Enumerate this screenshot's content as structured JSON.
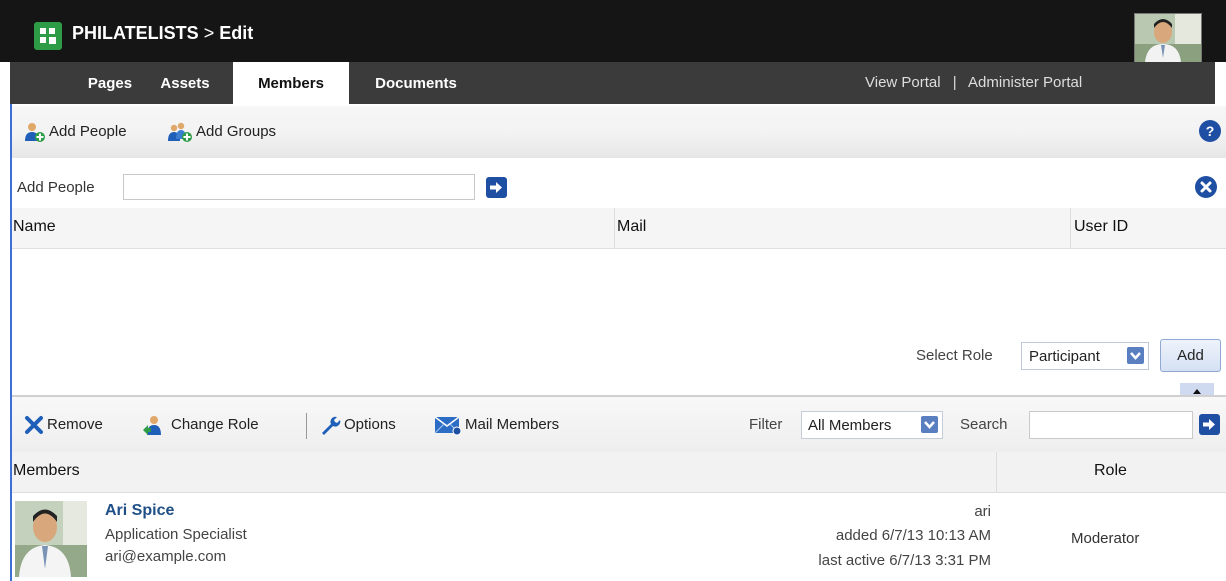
{
  "header": {
    "space_name": "PHILATELISTS",
    "separator": ">",
    "mode": "Edit"
  },
  "tabs": [
    {
      "label": "Pages"
    },
    {
      "label": "Assets"
    },
    {
      "label": "Members",
      "active": true
    },
    {
      "label": "Documents"
    }
  ],
  "portal_links": {
    "view": "View Portal",
    "divider": "|",
    "administer": "Administer Portal"
  },
  "toolbar": {
    "add_people": "Add People",
    "add_groups": "Add Groups"
  },
  "add_form": {
    "label": "Add People",
    "input_value": ""
  },
  "results_table": {
    "columns": [
      "Name",
      "Mail",
      "User ID"
    ]
  },
  "role_picker": {
    "label": "Select Role",
    "selected": "Participant",
    "add_label": "Add"
  },
  "members_toolbar": {
    "remove": "Remove",
    "change_role": "Change Role",
    "options": "Options",
    "mail_members": "Mail Members",
    "filter_label": "Filter",
    "filter_value": "All Members",
    "search_label": "Search",
    "search_value": ""
  },
  "members_table": {
    "columns": [
      "Members",
      "Role"
    ],
    "rows": [
      {
        "name": "Ari Spice",
        "title": "Application Specialist",
        "email": "ari@example.com",
        "user_id": "ari",
        "added": "added 6/7/13 10:13 AM",
        "last_active": "last active 6/7/13 3:31 PM",
        "role": "Moderator"
      }
    ]
  },
  "colors": {
    "top_bar": "#151515",
    "tab_bar": "#3b3b3b",
    "accent_blue": "#1f4fa3",
    "link_blue": "#1f4f86",
    "logo_green": "#2e9c47"
  }
}
